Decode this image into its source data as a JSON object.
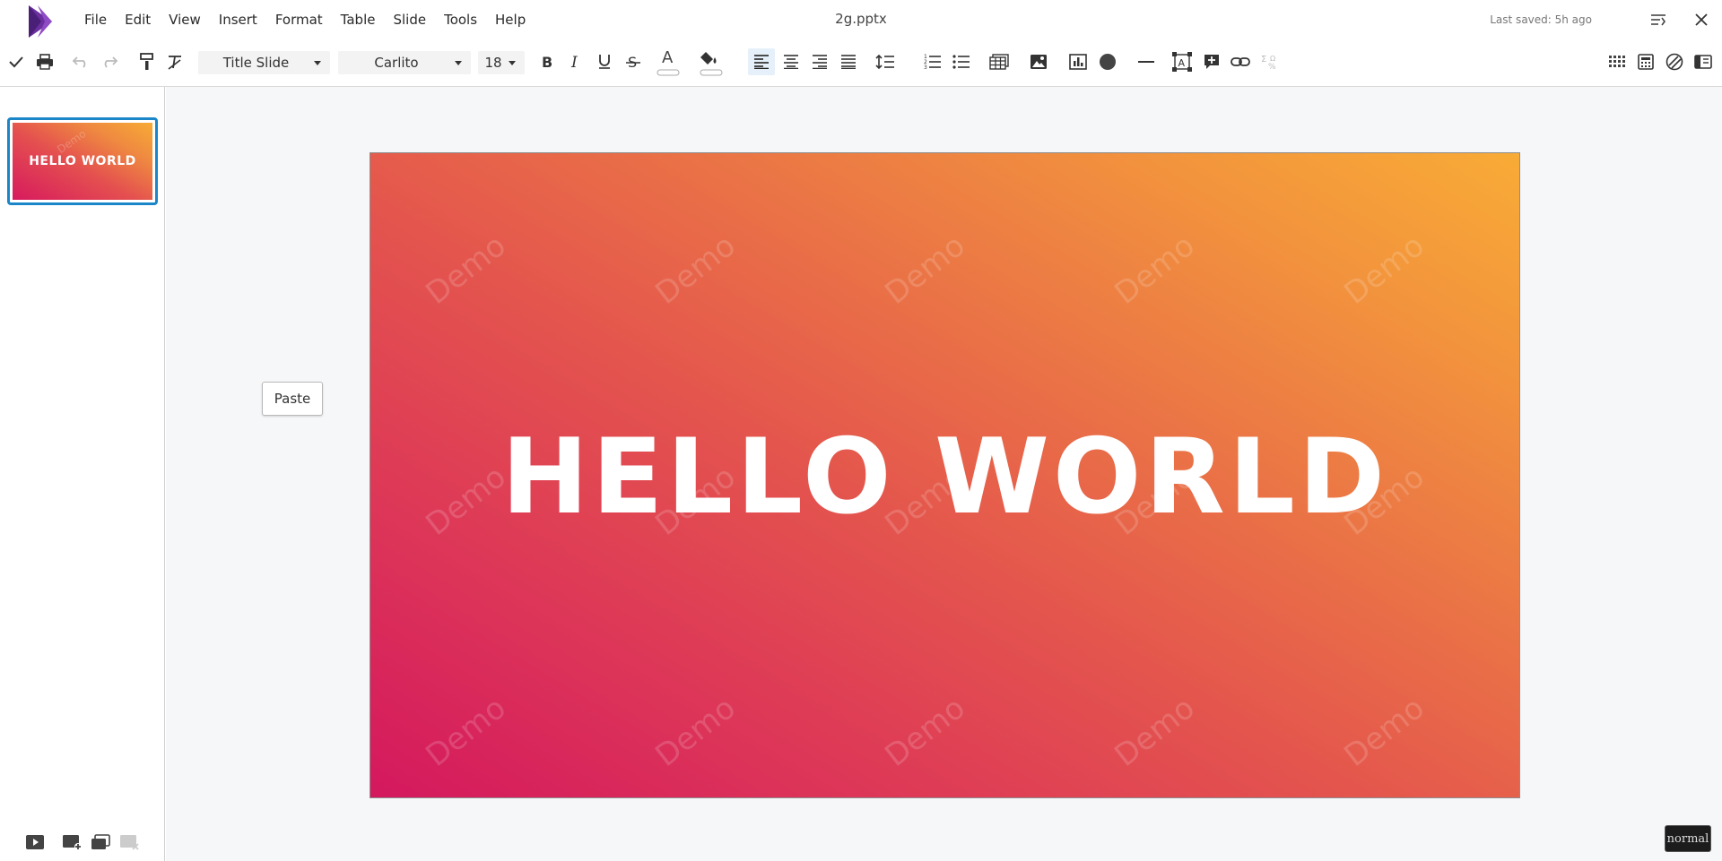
{
  "app": {
    "title": "2g.pptx",
    "last_saved": "Last saved: 5h ago",
    "brand_color": "#5b2a8c"
  },
  "menu": [
    "File",
    "Edit",
    "View",
    "Insert",
    "Format",
    "Table",
    "Slide",
    "Tools",
    "Help"
  ],
  "toolbar": {
    "layout_select": "Title Slide",
    "font_select": "Carlito",
    "size_select": "18",
    "icons": [
      "check-icon",
      "print-icon",
      "undo-icon",
      "redo-icon",
      "format-painter-icon",
      "clear-format-icon",
      "bold-icon",
      "italic-icon",
      "underline-icon",
      "strikethrough-icon",
      "font-color-icon",
      "highlight-color-icon",
      "align-left-icon",
      "align-center-icon",
      "align-right-icon",
      "align-justify-icon",
      "line-spacing-icon",
      "numbered-list-icon",
      "bullet-list-icon",
      "table-icon",
      "image-icon",
      "chart-icon",
      "shape-icon",
      "line-icon",
      "textbox-icon",
      "comment-icon",
      "link-icon",
      "special-char-icon",
      "grid-icon",
      "calculator-icon",
      "objects-icon",
      "sidebar-icon"
    ]
  },
  "slides": [
    {
      "title": "HELLO WORLD"
    }
  ],
  "slide": {
    "title": "HELLO WORLD",
    "watermark": "Demo",
    "gradient_start": "#d4185e",
    "gradient_end": "#f8ab36"
  },
  "context": {
    "paste_label": "Paste"
  },
  "status": {
    "mode": "normal"
  }
}
